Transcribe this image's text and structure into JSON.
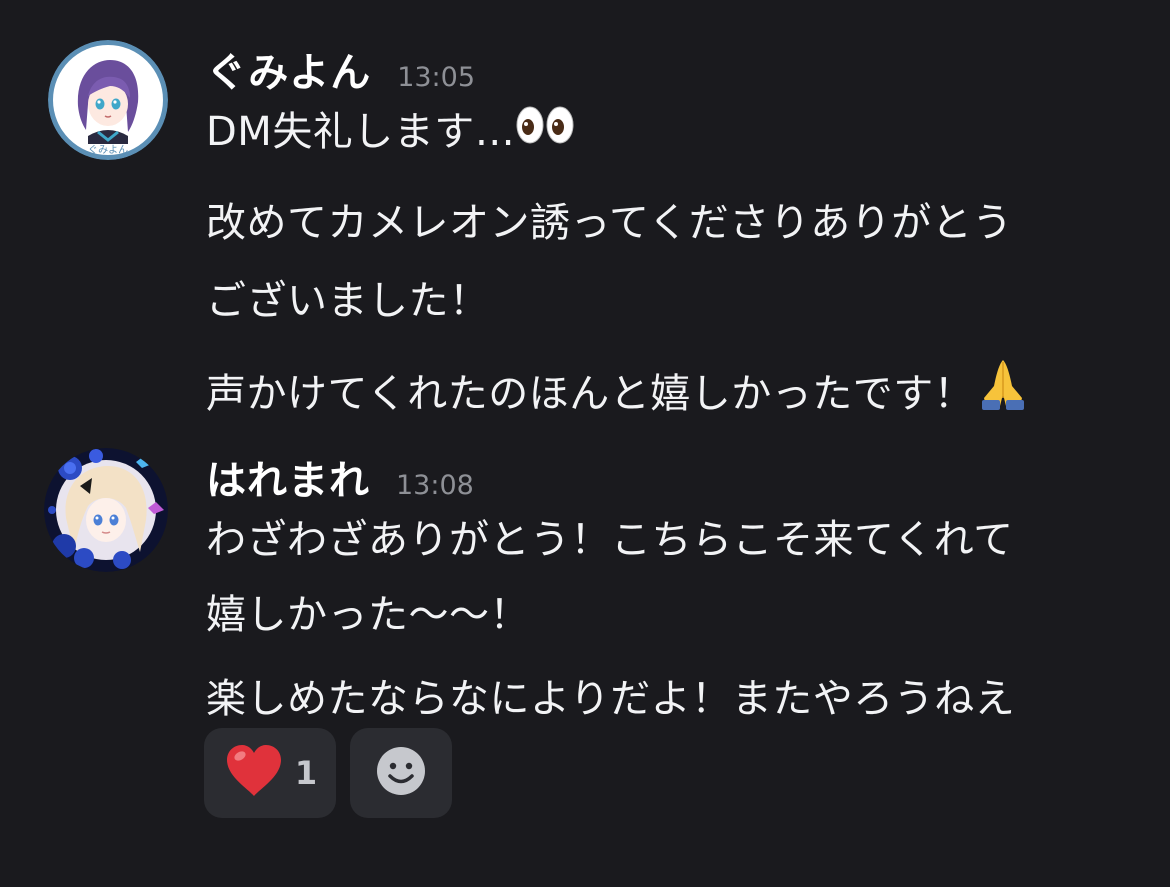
{
  "messages": [
    {
      "username": "ぐみよん",
      "timestamp": "13:05",
      "avatar_text": "ぐみよん",
      "lines": [
        "DM失礼します…",
        "改めてカメレオン誘ってくださりありがとう",
        "ございました！",
        "声かけてくれたのほんと嬉しかったです！"
      ],
      "line_emojis": [
        "eyes-emoji",
        "",
        "",
        "folded-hands-emoji"
      ]
    },
    {
      "username": "はれまれ",
      "timestamp": "13:08",
      "lines": [
        "わざわざありがとう！こちらこそ来てくれて",
        "嬉しかった〜〜！",
        "楽しめたならなによりだよ！またやろうねえ"
      ]
    }
  ],
  "reactions": [
    {
      "emoji": "heart-emoji",
      "count": "1"
    },
    {
      "emoji": "add-reaction-smiley-icon"
    }
  ],
  "colors": {
    "background": "#1a1a1e",
    "text": "#f2f3f5",
    "timestamp": "#8e9096",
    "reaction_bg": "#2b2c31",
    "heart": "#e0323b"
  }
}
